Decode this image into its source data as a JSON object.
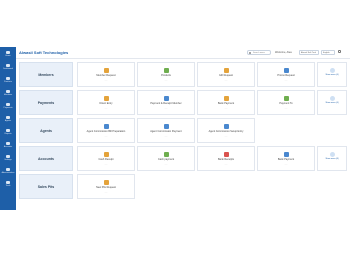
{
  "app": {
    "title": "Alwasil Soft Technologies"
  },
  "colors": {
    "primary": "#1e5fa8",
    "row_label_bg": "#e9f0f9",
    "icon_orange": "#e4a33b",
    "icon_green": "#6fae4f",
    "icon_red": "#d9534f",
    "icon_blue": "#4a88cf"
  },
  "topbar": {
    "search_placeholder": "Search menu",
    "welcome_text": "Welcome, Alea",
    "company_select": "Alwasil Soft Tech",
    "lang_select": "English"
  },
  "sidebar": {
    "items": [
      {
        "label": "Home",
        "icon": "home-icon"
      },
      {
        "label": "Dashboard",
        "icon": "dashboard-icon"
      },
      {
        "label": "Products",
        "icon": "box-icon"
      },
      {
        "label": "Members",
        "icon": "users-icon"
      },
      {
        "label": "Payments",
        "icon": "card-icon"
      },
      {
        "label": "Agents",
        "icon": "user-icon"
      },
      {
        "label": "Reports",
        "icon": "chart-icon"
      },
      {
        "label": "Accounts",
        "icon": "wallet-icon"
      },
      {
        "label": "Settings",
        "icon": "gear-icon"
      },
      {
        "label": "Administration",
        "icon": "shield-icon"
      },
      {
        "label": "Tools",
        "icon": "wrench-icon"
      }
    ]
  },
  "rows": [
    {
      "label": "Members",
      "cards": [
        {
          "label": "Member Request",
          "icon": "user-plus-icon",
          "color": "#e4a33b"
        },
        {
          "label": "Products",
          "icon": "box-icon",
          "color": "#6fae4f"
        },
        {
          "label": "Gift Request",
          "icon": "gift-icon",
          "color": "#e4a33b"
        },
        {
          "label": "Promo Request",
          "icon": "tag-icon",
          "color": "#4a88cf"
        }
      ],
      "more": "Show more (4)"
    },
    {
      "label": "Payments",
      "cards": [
        {
          "label": "Direct Entry",
          "icon": "hand-money-icon",
          "color": "#e4a33b"
        },
        {
          "label": "Payment & Receipt Member",
          "icon": "receipt-icon",
          "color": "#4a88cf"
        },
        {
          "label": "Bank Payment",
          "icon": "bank-icon",
          "color": "#e4a33b"
        },
        {
          "label": "Payment To",
          "icon": "transfer-icon",
          "color": "#6fae4f"
        }
      ],
      "more": "Show more (4)"
    },
    {
      "label": "Agents",
      "cards": [
        {
          "label": "Agent Commission Bill Preparation",
          "icon": "agent-icon",
          "color": "#4a88cf"
        },
        {
          "label": "Agent Commission Payment",
          "icon": "agent-pay-icon",
          "color": "#4a88cf"
        },
        {
          "label": "Agent Commission Setup Entry",
          "icon": "agent-setup-icon",
          "color": "#4a88cf"
        }
      ],
      "more": ""
    },
    {
      "label": "Accounts",
      "cards": [
        {
          "label": "Cash Receipt",
          "icon": "cash-icon",
          "color": "#e4a33b"
        },
        {
          "label": "Cash payment",
          "icon": "cash-out-icon",
          "color": "#6fae4f"
        },
        {
          "label": "Bank Receipts",
          "icon": "bank-receipt-icon",
          "color": "#d9534f"
        },
        {
          "label": "Bank Payment",
          "icon": "bank-pay-icon",
          "color": "#4a88cf"
        }
      ],
      "more": "Show more (8)"
    },
    {
      "label": "Sales Pits",
      "cards": [
        {
          "label": "New Pits Request",
          "icon": "cart-icon",
          "color": "#e4a33b"
        }
      ],
      "more": ""
    }
  ]
}
